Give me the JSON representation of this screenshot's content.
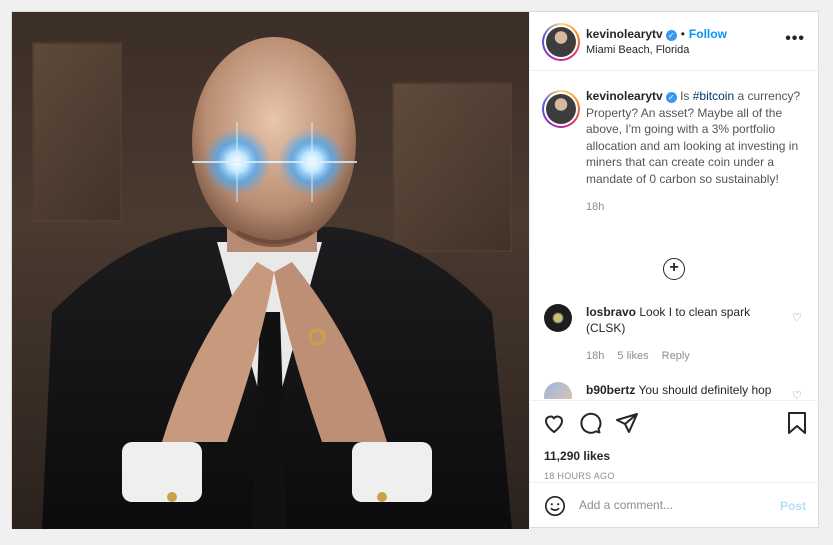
{
  "post": {
    "username": "kevinolearytv",
    "follow_label": "Follow",
    "location": "Miami Beach, Florida",
    "more_icon": "more-horizontal-icon",
    "caption_prefix": "Is",
    "caption_tag": "#bitcoin",
    "caption_text": "a currency? Property? An asset? Maybe all of the above, I'm going with a 3% portfolio allocation and am looking at investing in miners that can create coin under a mandate of 0 carbon so sustainably!",
    "caption_time": "18h",
    "likes": "11,290 likes",
    "posted_ago": "18 HOURS AGO"
  },
  "comments": [
    {
      "username": "losbravo",
      "text": "Look I to clean spark (CLSK)",
      "time": "18h",
      "likes": "5 likes",
      "reply": "Reply"
    },
    {
      "username": "b90bertz",
      "text": "You should definitely hop into ADA!!"
    }
  ],
  "add_comment": {
    "placeholder": "Add a comment...",
    "post_label": "Post"
  },
  "colors": {
    "accent": "#0095f6",
    "post_disabled": "#b2dffc",
    "tag": "#00376b"
  }
}
